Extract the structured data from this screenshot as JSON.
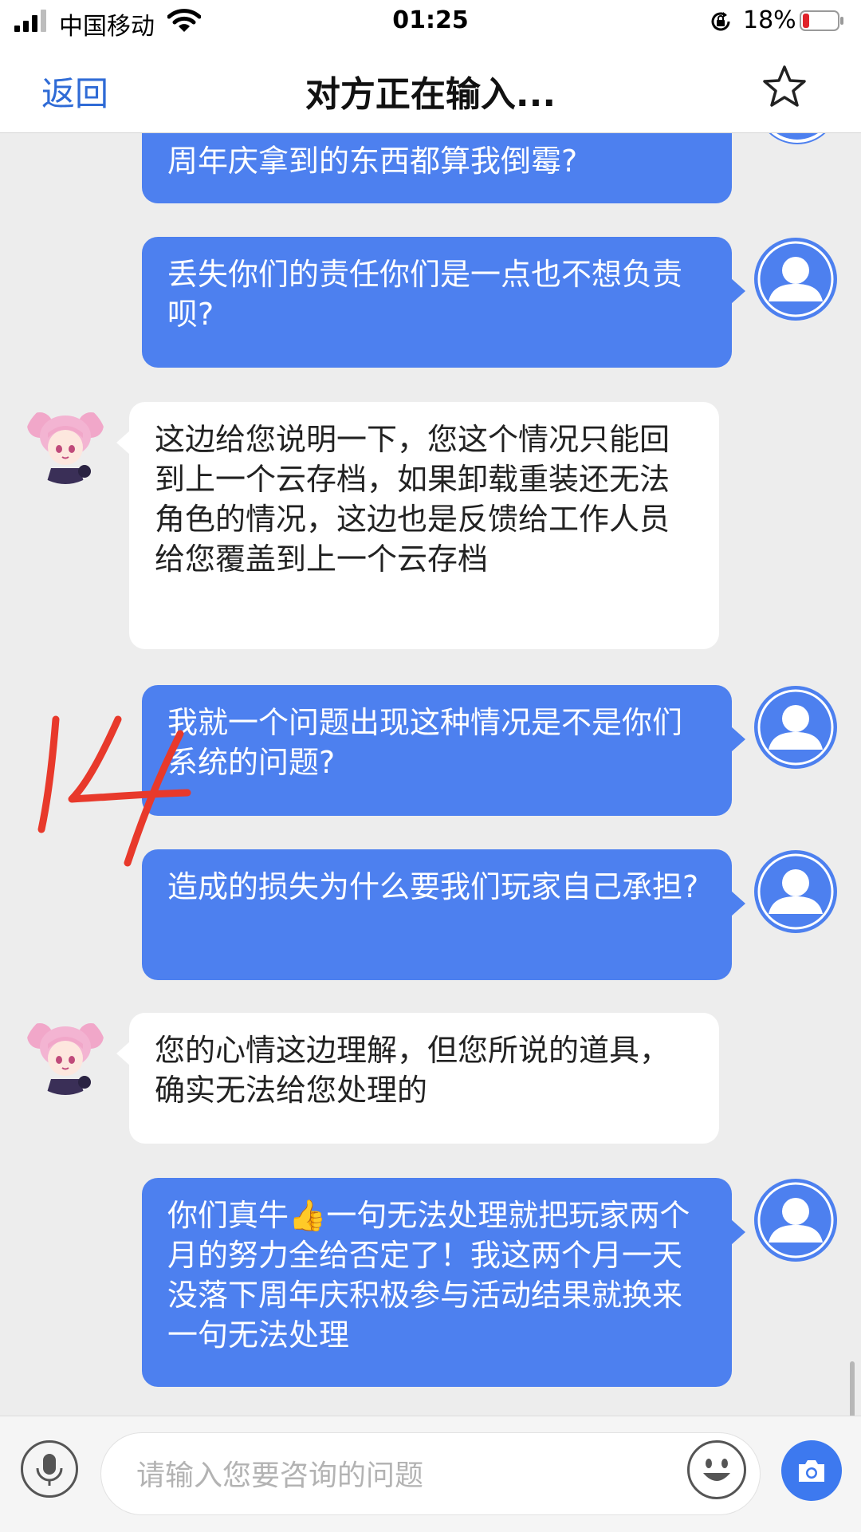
{
  "status_bar": {
    "carrier": "中国移动",
    "time": "01:25",
    "battery_percent": "18%",
    "battery_level": 0.18,
    "battery_color": "#e0232a"
  },
  "nav": {
    "back_label": "返回",
    "title": "对方正在输入...",
    "favorite_icon": "star-outline-icon"
  },
  "messages": [
    {
      "sender": "user",
      "text": "周年庆拿到的东西都算我倒霉?"
    },
    {
      "sender": "user",
      "text": "丢失你们的责任你们是一点也不想负责呗?"
    },
    {
      "sender": "agent",
      "text": "这边给您说明一下，您这个情况只能回到上一个云存档，如果卸载重装还无法角色的情况，这边也是反馈给工作人员给您覆盖到上一个云存档"
    },
    {
      "sender": "user",
      "text": "我就一个问题出现这种情况是不是你们系统的问题?"
    },
    {
      "sender": "user",
      "text": "造成的损失为什么要我们玩家自己承担?"
    },
    {
      "sender": "agent",
      "text": "您的心情这边理解，但您所说的道具，确实无法给您处理的"
    },
    {
      "sender": "user",
      "text_before": "你们真牛",
      "emoji": "👍",
      "text_after": "一句无法处理就把玩家两个月的努力全给否定了！我这两个月一天没落下周年庆积极参与活动结果就换来一句无法处理"
    }
  ],
  "annotation": {
    "text": "14",
    "color": "#e8392b"
  },
  "input": {
    "placeholder": "请输入您要咨询的问题",
    "icons": [
      "microphone-icon",
      "emoji-icon",
      "camera-icon"
    ]
  },
  "colors": {
    "accent": "#2f6bd6",
    "user_bubble": "#4d80ef",
    "agent_bubble": "#ffffff",
    "background": "#ededed"
  }
}
